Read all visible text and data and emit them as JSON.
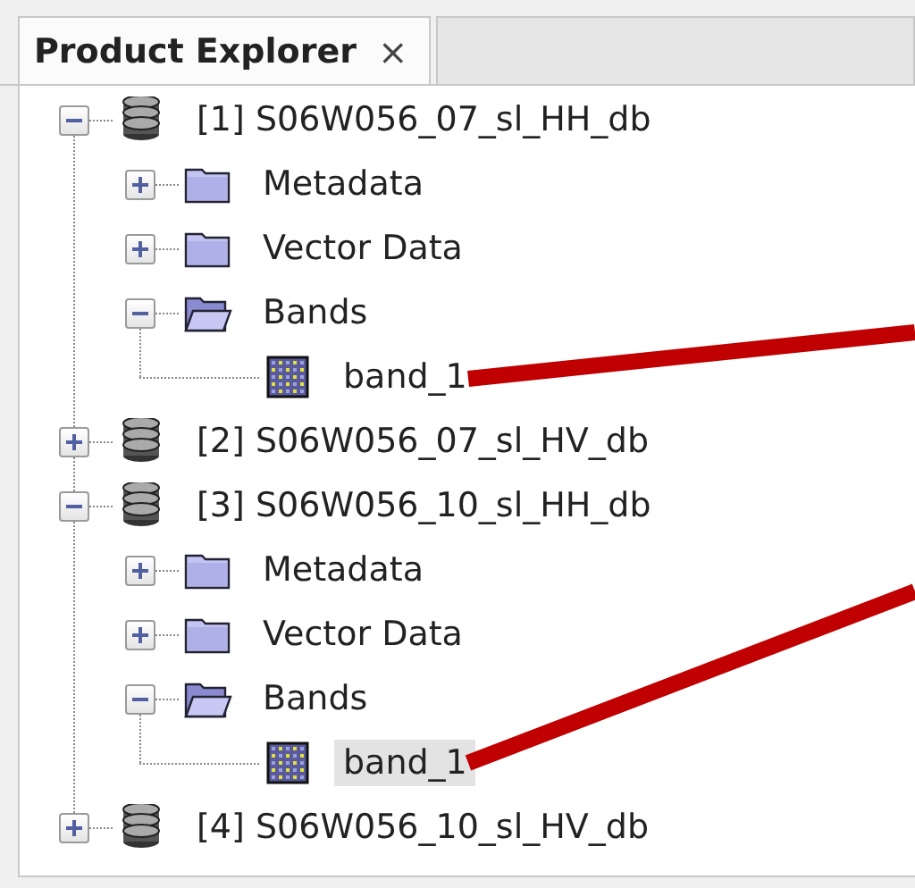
{
  "tab": {
    "title": "Product Explorer",
    "close": "×"
  },
  "tree": [
    {
      "kind": "product",
      "label": "[1] S06W056_07_sl_HH_db",
      "expanded": true,
      "selected": false,
      "children": [
        {
          "kind": "folder",
          "label": "Metadata",
          "expanded": false,
          "selected": false
        },
        {
          "kind": "folder",
          "label": "Vector Data",
          "expanded": false,
          "selected": false
        },
        {
          "kind": "folder",
          "label": "Bands",
          "expanded": true,
          "selected": false,
          "children": [
            {
              "kind": "band",
              "label": "band_1",
              "selected": false
            }
          ]
        }
      ]
    },
    {
      "kind": "product",
      "label": "[2] S06W056_07_sl_HV_db",
      "expanded": false,
      "selected": false
    },
    {
      "kind": "product",
      "label": "[3] S06W056_10_sl_HH_db",
      "expanded": true,
      "selected": false,
      "children": [
        {
          "kind": "folder",
          "label": "Metadata",
          "expanded": false,
          "selected": false
        },
        {
          "kind": "folder",
          "label": "Vector Data",
          "expanded": false,
          "selected": false
        },
        {
          "kind": "folder",
          "label": "Bands",
          "expanded": true,
          "selected": false,
          "children": [
            {
              "kind": "band",
              "label": "band_1",
              "selected": true
            }
          ]
        }
      ]
    },
    {
      "kind": "product",
      "label": "[4] S06W056_10_sl_HV_db",
      "expanded": false,
      "selected": false
    }
  ]
}
